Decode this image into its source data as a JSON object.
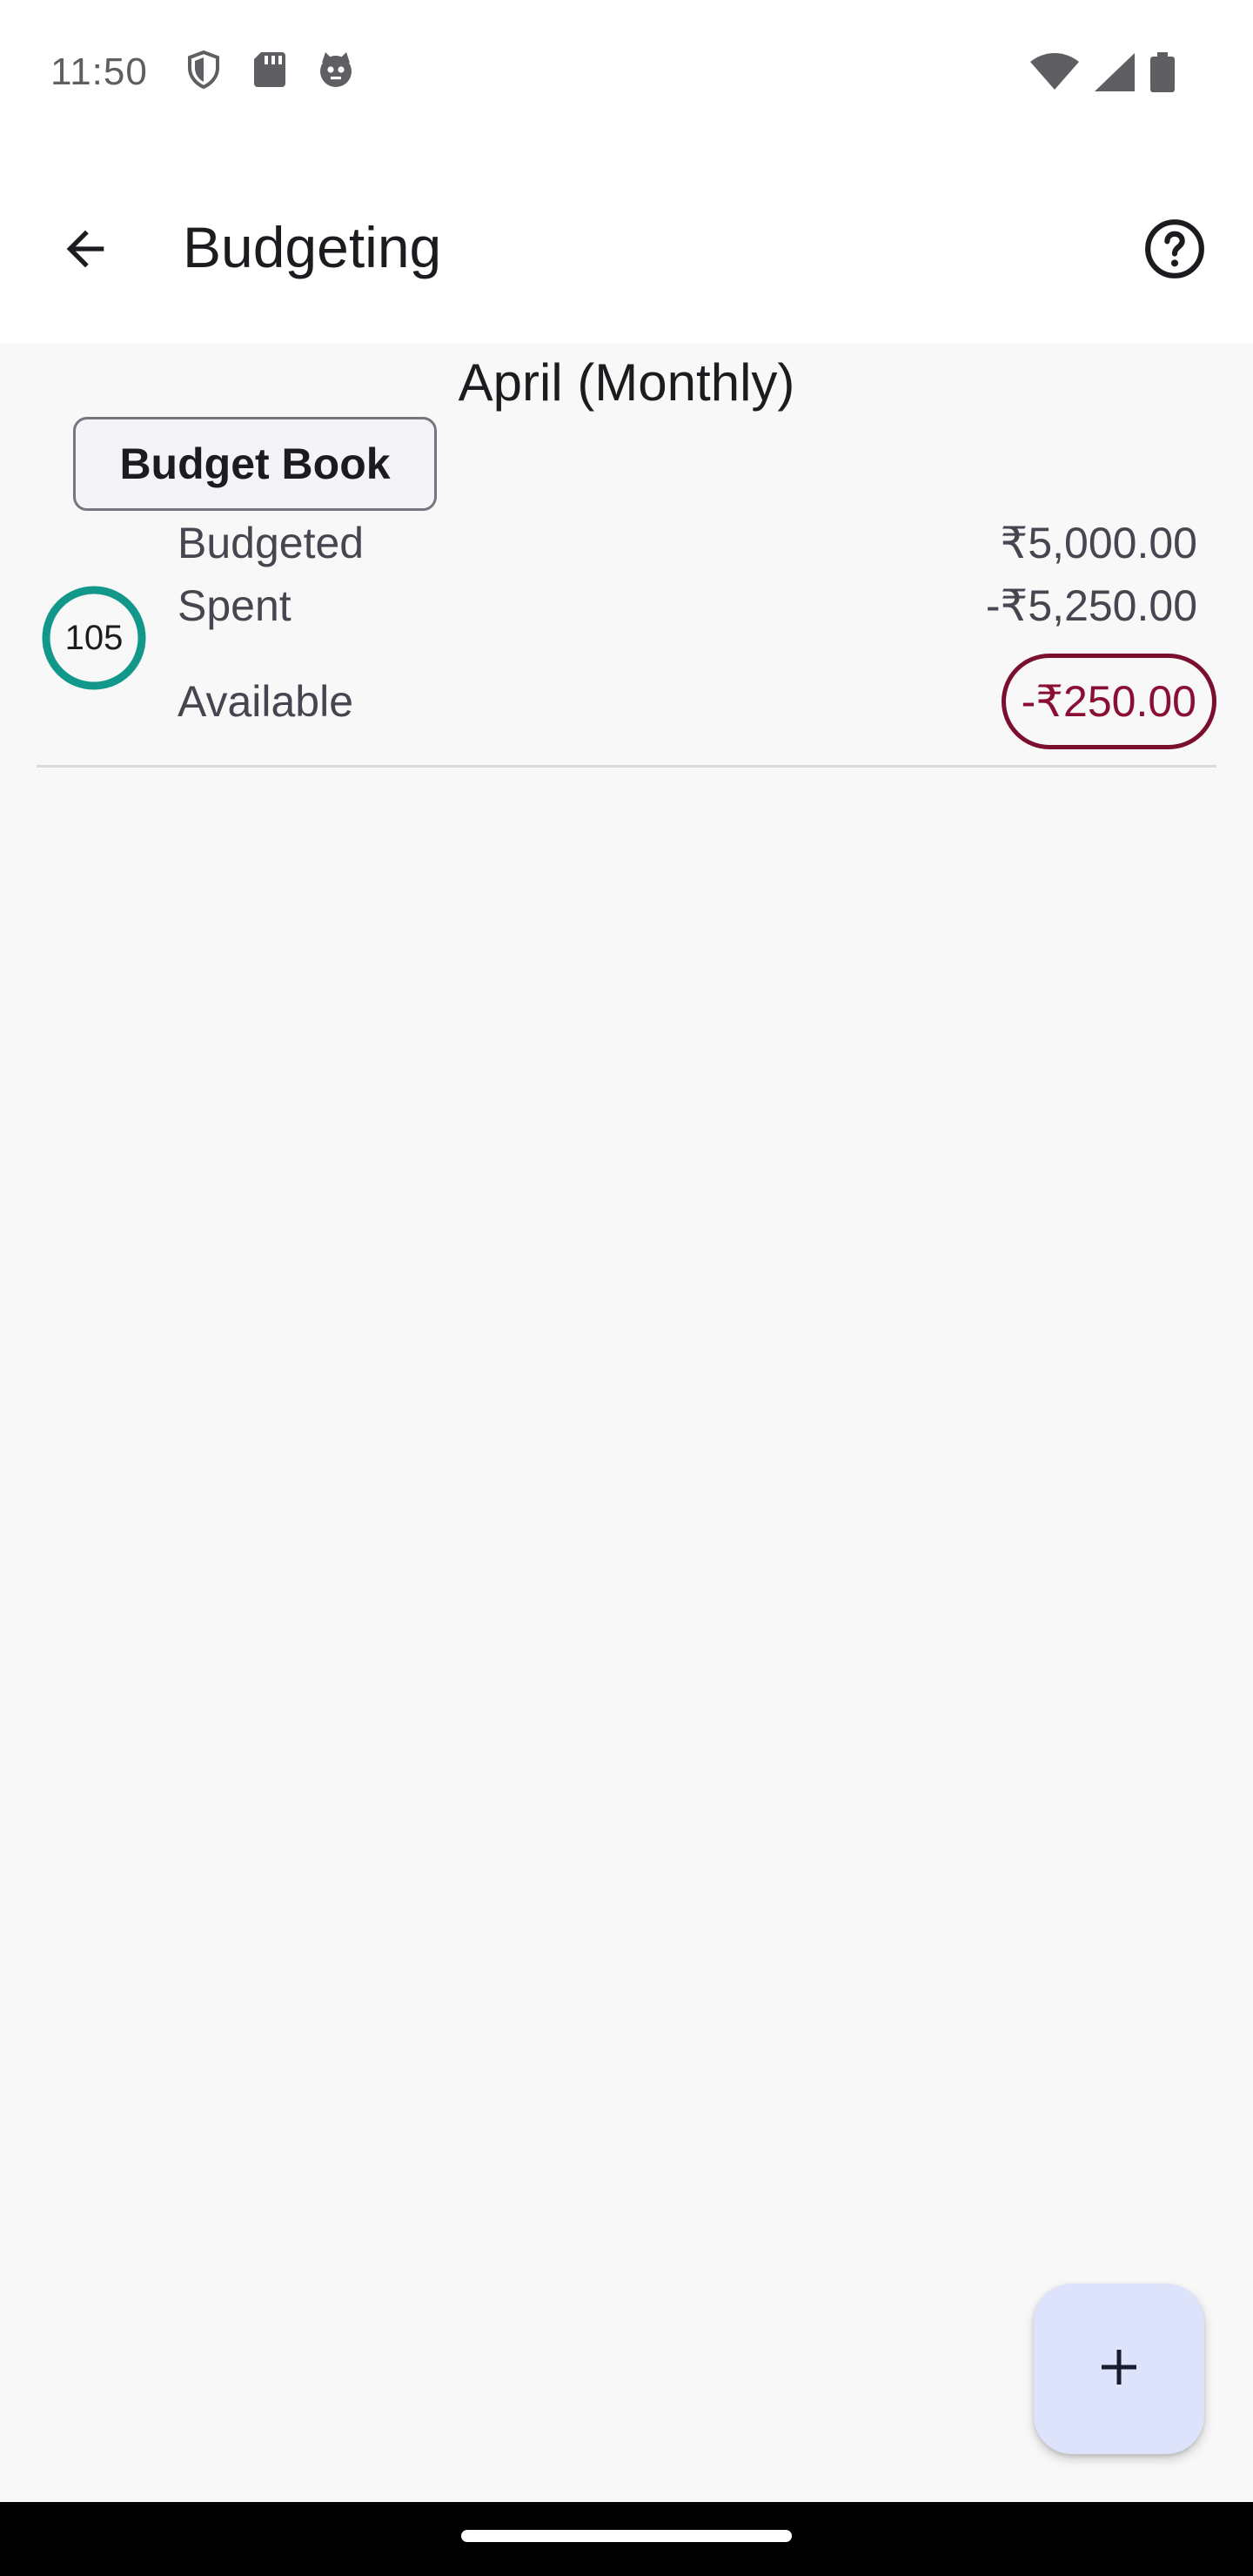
{
  "status_bar": {
    "time": "11:50",
    "icons_left": [
      "shield-icon",
      "sd-card-icon",
      "cat-face-icon"
    ],
    "icons_right": [
      "wifi-icon",
      "cellular-signal-icon",
      "battery-icon"
    ]
  },
  "app_bar": {
    "title": "Budgeting",
    "back_icon": "arrow-back-icon",
    "help_icon": "help-circle-icon"
  },
  "budget": {
    "period_title": "April (Monthly)",
    "book_chip_label": "Budget Book",
    "progress_percent": "105",
    "budgeted_label": "Budgeted",
    "budgeted_value": "₹5,000.00",
    "spent_label": "Spent",
    "spent_value": "-₹5,250.00",
    "available_label": "Available",
    "available_value": "-₹250.00"
  },
  "fab": {
    "icon": "plus-icon"
  },
  "colors": {
    "progress_ring": "#12988a",
    "negative_available": "#7a0f2e",
    "fab_background": "#dde3fb",
    "background": "#f8f8f9"
  }
}
